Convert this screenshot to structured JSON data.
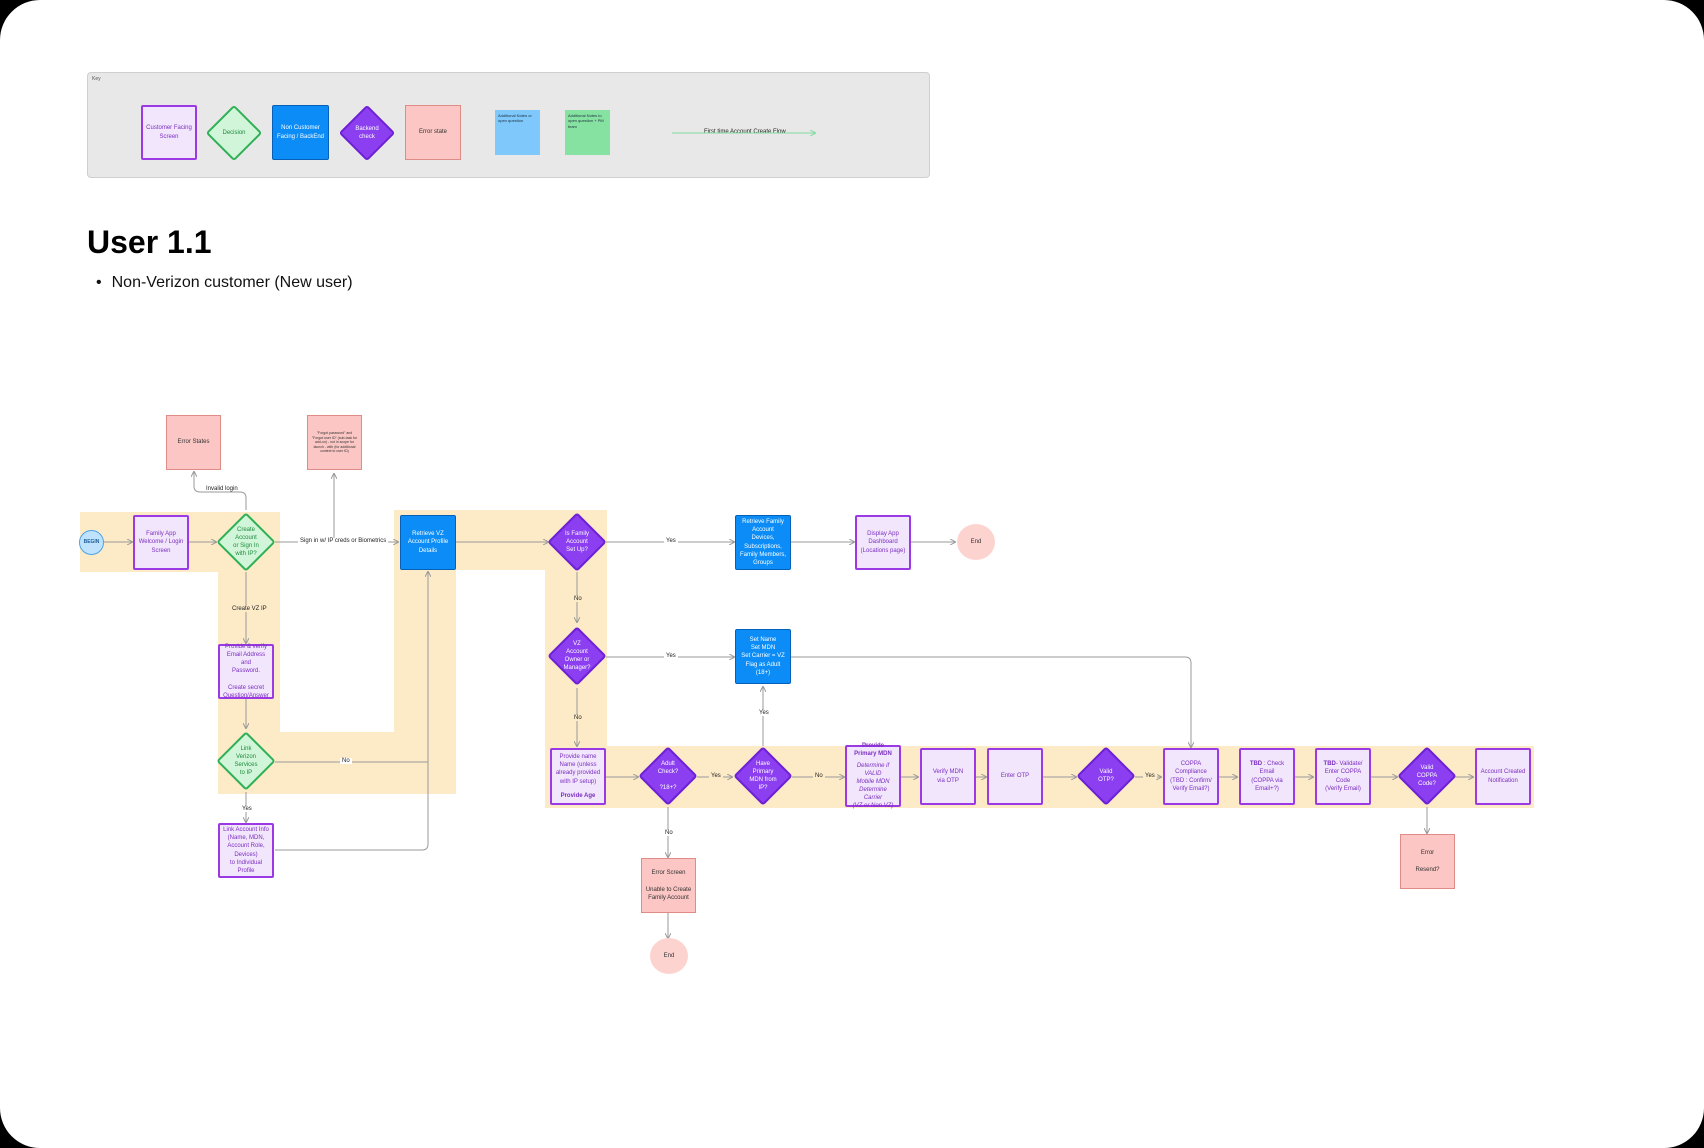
{
  "key": {
    "label": "Key",
    "customer_screen": "Customer Facing\nScreen",
    "decision": "Decision",
    "backend": "Non Customer\nFacing / BackEnd",
    "backend_check": "Backend\ncheck",
    "error_state": "Error state",
    "sticky_blue": "Additional Notes or open question",
    "sticky_green": "Additional Notes to open question + PM team",
    "flow_line": "First time Account Create Flow"
  },
  "heading": {
    "title": "User 1.1",
    "bullet": "Non-Verizon customer (New user)"
  },
  "colors": {
    "screen_fill": "#f2e6fc",
    "screen_border": "#9b39e4",
    "backend_fill": "#0b8cf6",
    "error_fill": "#fbc6c3",
    "decision_fill": "#d1f5d8",
    "check_fill": "#8b3ff0",
    "highlight": "#fdebc8",
    "flow_line": "#7fdca0"
  },
  "nodes": {
    "error_states": "Error States",
    "forgot_note": "\"Forgot password\" and \"Forgot user ID\" (sub-task for add-on) - not in scope for launch - with (for additional context to user ID)",
    "begin": "BEGIN",
    "welcome": "Family App\nWelcome / Login\nScreen",
    "create_account": "Create\nAccount\nor Sign In\nwith IP?",
    "retrieve_vz": "Retrieve VZ\nAccount Profile\nDetails",
    "is_family": "Is Family\nAccount\nSet Up?",
    "retrieve_family": "Retrieve Family\nAccount\nDevices,\nSubscriptions,\nFamily Members,\nGroups",
    "display_dashboard": "Display App\nDashboard\n(Locations page)",
    "end_top": "End",
    "vz_owner": "VZ\nAccount\nOwner or\nManager?",
    "set_name": "Set Name\nSet MDN\nSet Carrier = VZ\nFlag as Adult (18+)",
    "provide_email": "Provide & verify\nEmail Address and\nPassword.\n\nCreate secret\nQuestion/Answer",
    "link_verizon": "Link\nVerizon\nServices\nto IP",
    "link_account": "Link Account Info\n(Name, MDN,\nAccount Role,\nDevices)\nto Individual Profile",
    "provide_name": "Provide name\nName (unless\nalready provided\nwith IP setup)",
    "provide_age": "Provide Age",
    "adult_check": "Adult\nCheck?\n\n?18+?",
    "have_mdn": "Have\nPrimary\nMDN from\nIP?",
    "provide_mdn_title": "Provide\nPrimary MDN",
    "provide_mdn_sub": "Determine if VALID\nMobile MDN\nDetermine Carrier\n(VZ or Non VZ)",
    "verify_mdn": "Verify MDN\nvia OTP",
    "enter_otp": "Enter OTP",
    "valid_otp": "Valid\nOTP?",
    "coppa": "COPPA\nCompliance\n(TBD : Confirm/\nVerify Email?)",
    "tbd_check_prefix": "TBD",
    "tbd_check": " : Check Email\n(COPPA via\nEmail+?)",
    "tbd_validate_prefix": "TBD",
    "tbd_validate": "- Validate/\nEnter COPPA Code\n(Verify Email)",
    "valid_coppa": "Valid\nCOPPA\nCode?",
    "account_created": "Account Created\nNotification",
    "error_resend": "Error\n\nResend?",
    "error_screen": "Error Screen\n\nUnable to Create\nFamily Account",
    "end_bottom": "End"
  },
  "edge_labels": {
    "invalid_login": "Invalid login",
    "sign_in": "Sign in w/ IP creds or Biometrics",
    "create_vz_ip": "Create VZ IP",
    "no_link": "No",
    "yes_link": "Yes",
    "yes_family": "Yes",
    "no_family": "No",
    "yes_owner": "Yes",
    "no_owner": "No",
    "yes_adult": "Yes",
    "no_adult": "No",
    "yes_mdn": "Yes",
    "no_mdn": "No",
    "yes_otp": "Yes"
  }
}
